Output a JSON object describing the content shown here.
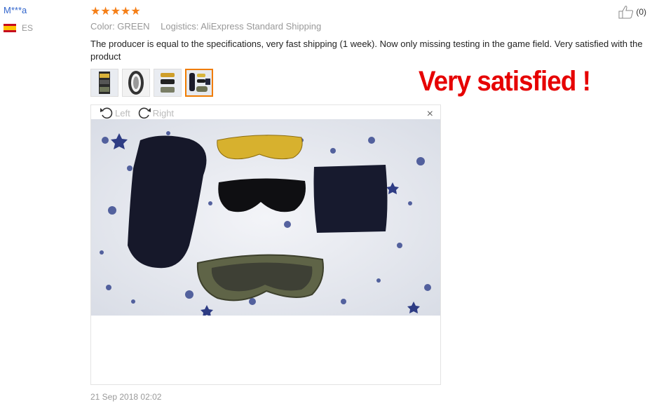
{
  "reviewer": {
    "name": "M***a",
    "country_code": "ES"
  },
  "rating": {
    "stars": 5,
    "display": "★★★★★"
  },
  "meta": {
    "color": "Color: GREEN",
    "logistics": "Logistics: AliExpress Standard Shipping"
  },
  "review": {
    "text": "The producer is equal to the specifications, very fast shipping (1 week). Now only missing testing in the game field. Very satisfied with the product"
  },
  "helpful": {
    "count": "(0)",
    "icon": "thumbs-up-icon"
  },
  "gallery": {
    "thumbnails": [
      "photo-1",
      "photo-2",
      "photo-3",
      "photo-4"
    ],
    "selected_index": 3
  },
  "viewer": {
    "rotate_left": "Left",
    "rotate_right": "Right",
    "close": "×"
  },
  "overlay_text": "Very satisfied !",
  "review_date": "21 Sep 2018 02:02",
  "colors": {
    "star": "#f57f17",
    "link": "#3366cc",
    "accent": "#f07c00",
    "overlay": "#e60000"
  }
}
